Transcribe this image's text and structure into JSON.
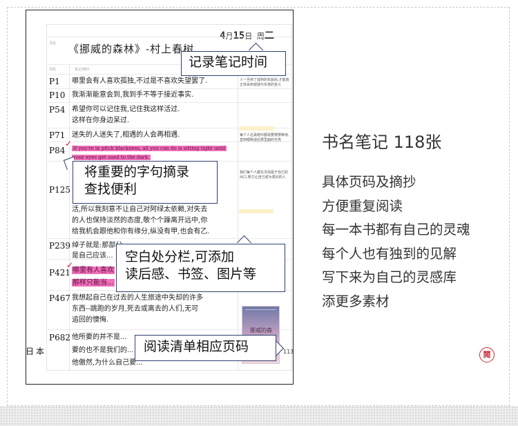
{
  "notebook": {
    "date": {
      "month": "4",
      "month_unit": "月",
      "day": "15",
      "day_unit": "日",
      "weekday_label": "周",
      "weekday": "二"
    },
    "title_label": "书名",
    "book_title": "《挪威的森林》-村上春树",
    "col_page_label": "页码",
    "col_notes_label": "笔记/摘抄",
    "entries": [
      {
        "page": "P1",
        "lines": [
          "哪里会有人喜欢孤独,不过是不喜欢失望罢了."
        ]
      },
      {
        "page": "P10",
        "lines": [
          "我渐渐能意会到,我到手不等于接近事实."
        ]
      },
      {
        "page": "P54",
        "lines": [
          "希望你可以记住我,记住我这样活过.",
          "这样在你身边呆过."
        ]
      },
      {
        "page": "P71",
        "lines": [
          "迷失的人迷失了,相遇的人会再相遇."
        ]
      },
      {
        "page": "P84",
        "lines": [
          "If you're in pitch blackness, all you can do is sitting tight until",
          "your eyes get used to the dark."
        ]
      },
      {
        "page": "P125",
        "lines": [
          "活,所以我刻意不让自己对阿绿太依赖,对失去",
          "的人也保持淡然的态度,敬个个躁离开远中,你",
          "给我机会跟他和你有缘分,纵没有甲,也会有乙."
        ]
      },
      {
        "page": "P239",
        "lines": [
          "绰子就是:那部分...",
          "是自己应该..."
        ]
      },
      {
        "page": "P421",
        "lines": [
          "哪里有人喜欢",
          "那样只能当..."
        ]
      },
      {
        "page": "P467",
        "lines": [
          "我想起自己在过去的人生旅途中失却的许多",
          "东西--跳跑的岁月,死去或离去的人们,无可",
          "追回的懊悔."
        ]
      },
      {
        "page": "P682",
        "lines": [
          "他所要的并不是...",
          "要的也不是我们的...",
          "他傲然,为什么自己要..."
        ]
      }
    ],
    "side_notes": [
      "人一旦到了成熟的年龄后,才能真正体会到孤独与失落的含义",
      "每个人在黑暗中都需要慢慢等待,直到眼睛适应那里面的光亮",
      "我们每个人都在寻找属于自己的出口,努力让自己成为更好的人"
    ],
    "book_cover_title": "挪威的森林",
    "country": "日本",
    "edge_number": "113"
  },
  "callouts": {
    "record_time": "记录笔记时间",
    "excerpt": [
      "将重要的字句摘录",
      "查找便利"
    ],
    "columns": [
      "空白处分栏,可添加",
      "读后感、书签、图片等"
    ],
    "reading_list": "阅读清单相应页码"
  },
  "right": {
    "title": "书名笔记  118张",
    "lines": [
      "具体页码及摘抄",
      "方便重复阅读",
      "每一本书都有自己的灵魂",
      "每个人也有独到的见解",
      "写下来为自己的灵感库",
      "添更多素材"
    ]
  },
  "stamp_glyph": "閱",
  "colors": {
    "highlight": "#f06fb8",
    "callout_border": "#2f3f6e",
    "check": "#e0152f",
    "stamp": "#c72b36"
  }
}
